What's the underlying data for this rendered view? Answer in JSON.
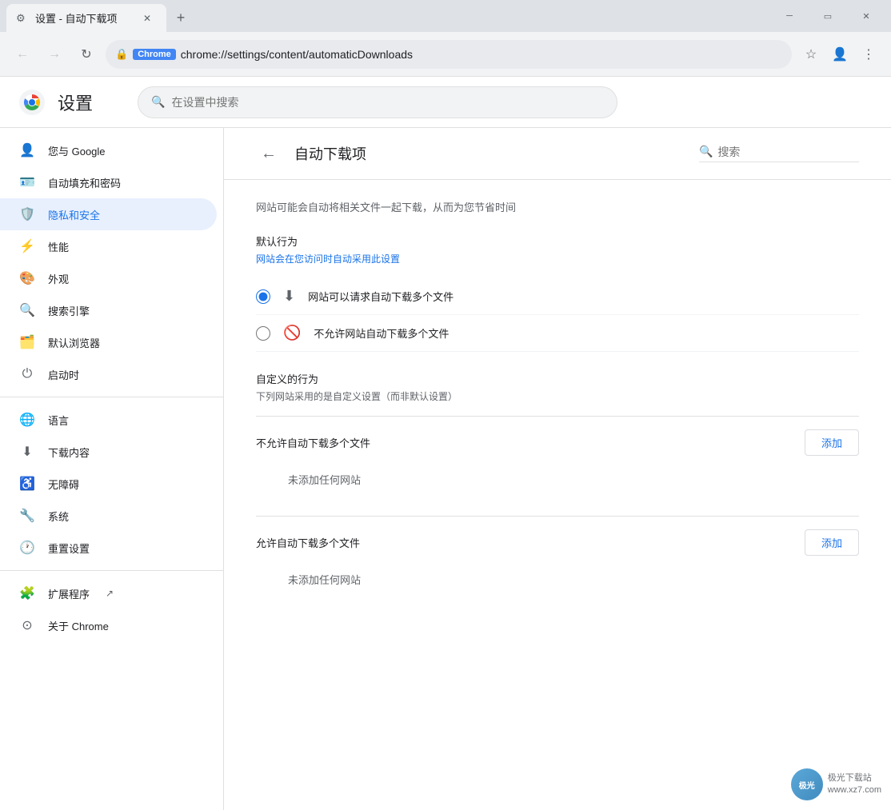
{
  "browser": {
    "tab_label": "设置 - 自动下载项",
    "new_tab_label": "+",
    "url": "chrome://settings/content/automaticDownloads",
    "chrome_badge": "Chrome",
    "back_tooltip": "后退",
    "forward_tooltip": "前进",
    "refresh_tooltip": "刷新"
  },
  "settings": {
    "title": "设置",
    "search_placeholder": "在设置中搜索"
  },
  "sidebar": {
    "items": [
      {
        "id": "google",
        "label": "您与 Google",
        "icon": "👤"
      },
      {
        "id": "autofill",
        "label": "自动填充和密码",
        "icon": "🪪"
      },
      {
        "id": "privacy",
        "label": "隐私和安全",
        "icon": "🛡️",
        "active": true
      },
      {
        "id": "performance",
        "label": "性能",
        "icon": "⚡"
      },
      {
        "id": "appearance",
        "label": "外观",
        "icon": "🎨"
      },
      {
        "id": "search",
        "label": "搜索引擎",
        "icon": "🔍"
      },
      {
        "id": "browser",
        "label": "默认浏览器",
        "icon": "🗂️"
      },
      {
        "id": "startup",
        "label": "启动时",
        "icon": "⏻"
      },
      {
        "id": "divider1",
        "type": "divider"
      },
      {
        "id": "language",
        "label": "语言",
        "icon": "🌐"
      },
      {
        "id": "downloads",
        "label": "下载内容",
        "icon": "⬇"
      },
      {
        "id": "accessibility",
        "label": "无障碍",
        "icon": "♿"
      },
      {
        "id": "system",
        "label": "系统",
        "icon": "🔧"
      },
      {
        "id": "reset",
        "label": "重置设置",
        "icon": "🕐"
      },
      {
        "id": "divider2",
        "type": "divider"
      },
      {
        "id": "extensions",
        "label": "扩展程序",
        "icon": "🧩",
        "external": true
      },
      {
        "id": "about",
        "label": "关于 Chrome",
        "icon": "⊙"
      }
    ]
  },
  "content": {
    "back_label": "←",
    "title": "自动下载项",
    "search_placeholder": "搜索",
    "info_text": "网站可能会自动将相关文件一起下载，从而为您节省时间",
    "default_section": {
      "title": "默认行为",
      "subtitle": "网站会在您访问时自动采用此设置"
    },
    "options": [
      {
        "id": "allow",
        "label": "网站可以请求自动下载多个文件",
        "selected": true
      },
      {
        "id": "block",
        "label": "不允许网站自动下载多个文件",
        "selected": false
      }
    ],
    "custom_section": {
      "title": "自定义的行为",
      "subtitle": "下列网站采用的是自定义设置（而非默认设置）"
    },
    "blocks": [
      {
        "id": "block-section",
        "label": "不允许自动下载多个文件",
        "add_label": "添加",
        "empty_text": "未添加任何网站"
      },
      {
        "id": "allow-section",
        "label": "允许自动下载多个文件",
        "add_label": "添加",
        "empty_text": "未添加任何网站"
      }
    ]
  },
  "watermark": {
    "site": "极光下载站",
    "url": "www.xz7.com"
  }
}
